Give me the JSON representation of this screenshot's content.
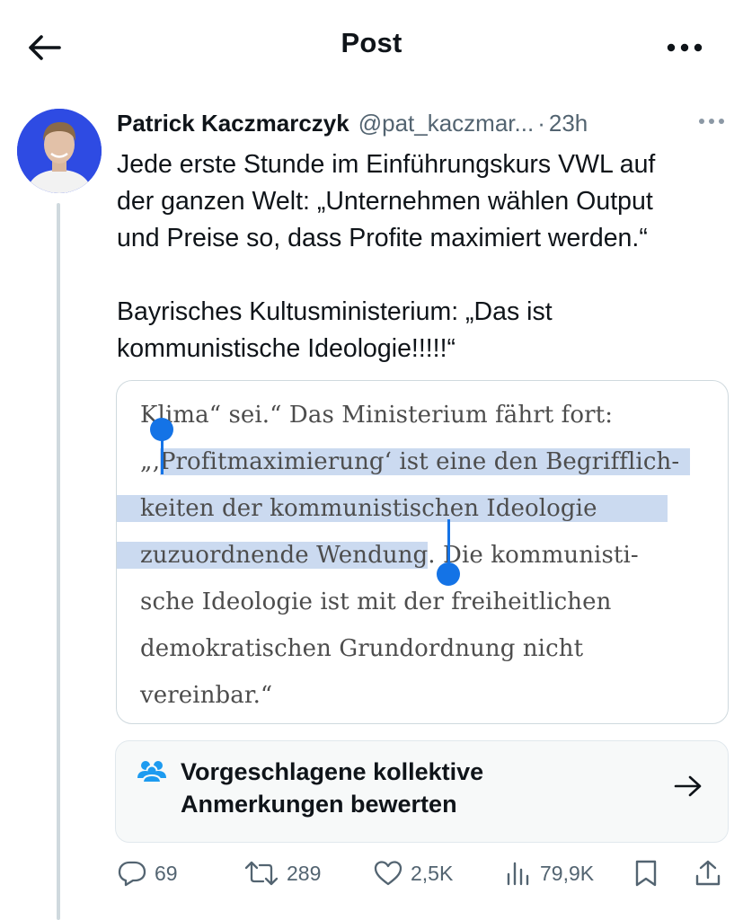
{
  "header": {
    "title": "Post",
    "back_icon": "arrow-left-icon",
    "more_icon": "more-horizontal-icon"
  },
  "post": {
    "author_name": "Patrick Kaczmarczyk",
    "author_handle": "@pat_kaczmar...",
    "separator": "·",
    "time": "23h",
    "text_lines": [
      "Jede erste Stunde im Einführungskurs VWL auf",
      "der ganzen Welt: „Unternehmen wählen Output",
      "und Preise so, dass Profite maximiert werden.“",
      "",
      "Bayrisches Kultusministerium: „Das ist",
      "kommunistische Ideologie!!!!!“"
    ]
  },
  "media": {
    "line1": "Klima“ sei.“ Das Ministerium fährt fort:",
    "line2_a": "„‚",
    "line2_b": "Profitmaximierung‘ ist eine den Begrifflich-",
    "line3": "keiten der kommunistischen Ideologie",
    "line4_a": "zuzuordnende Wendung",
    "line4_b": ". Die kommunisti-",
    "line5": "sche Ideologie ist mit der freiheitlichen",
    "line6": "demokratischen Grundordnung nicht",
    "line7": "vereinbar.“"
  },
  "community_notes": {
    "line1": "Vorgeschlagene kollektive",
    "line2": "Anmerkungen bewerten",
    "icon": "people-icon",
    "arrow_icon": "arrow-right-icon"
  },
  "actions": {
    "replies": "69",
    "reposts": "289",
    "likes": "2,5K",
    "views": "79,9K"
  },
  "colors": {
    "accent": "#1d9bf0",
    "selection": "#cbdaf0",
    "handle": "#1473e6",
    "secondary_text": "#536471"
  }
}
